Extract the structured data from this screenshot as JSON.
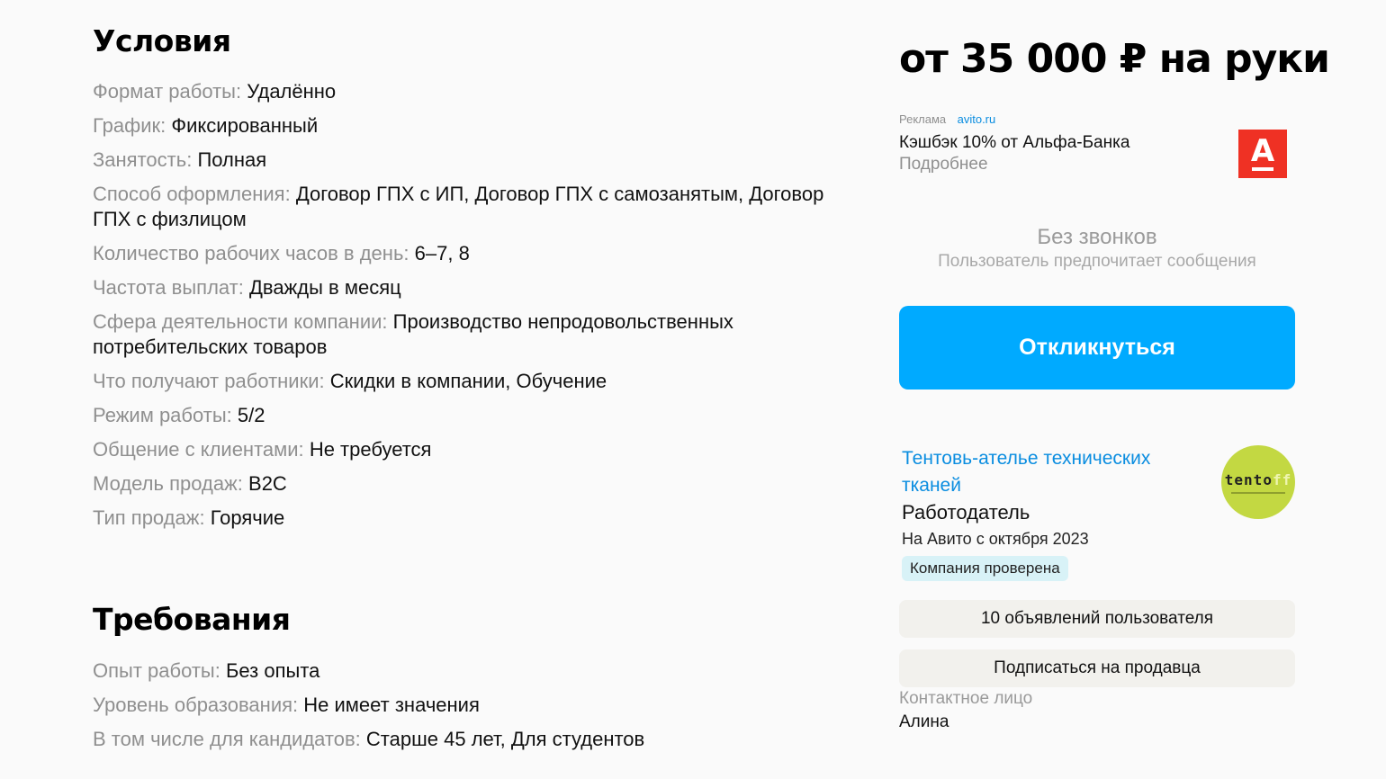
{
  "conditions": {
    "title": "Условия",
    "params": [
      {
        "label": "Формат работы:",
        "value": "Удалённо"
      },
      {
        "label": "График:",
        "value": "Фиксированный"
      },
      {
        "label": "Занятость:",
        "value": "Полная"
      },
      {
        "label": "Способ оформления:",
        "value": "Договор ГПХ с ИП, Договор ГПХ с самозанятым, Договор ГПХ с физлицом"
      },
      {
        "label": "Количество рабочих часов в день:",
        "value": "6–7, 8"
      },
      {
        "label": "Частота выплат:",
        "value": "Дважды в месяц"
      },
      {
        "label": "Сфера деятельности компании:",
        "value": "Производство непродовольственных потребительских товаров"
      },
      {
        "label": "Что получают работники:",
        "value": "Скидки в компании, Обучение"
      },
      {
        "label": "Режим работы:",
        "value": "5/2"
      },
      {
        "label": "Общение с клиентами:",
        "value": "Не требуется"
      },
      {
        "label": "Модель продаж:",
        "value": "B2C"
      },
      {
        "label": "Тип продаж:",
        "value": "Горячие"
      }
    ]
  },
  "requirements": {
    "title": "Требования",
    "params": [
      {
        "label": "Опыт работы:",
        "value": "Без опыта"
      },
      {
        "label": "Уровень образования:",
        "value": "Не имеет значения"
      },
      {
        "label": "В том числе для кандидатов:",
        "value": "Старше 45 лет, Для студентов"
      }
    ]
  },
  "sidebar": {
    "price": "от 35 000 ₽ на руки",
    "ad": {
      "label": "Реклама",
      "domain": "avito.ru",
      "title": "Кэшбэк 10% от Альфа-Банка",
      "more": "Подробнее",
      "logo_letter": "А",
      "logo_color": "#ef3124"
    },
    "no_calls": {
      "title": "Без звонков",
      "subtitle": "Пользователь предпочитает сообщения"
    },
    "respond_button": "Откликнуться",
    "company": {
      "name": "Тентовь-ателье технических тканей",
      "role": "Работодатель",
      "since": "На Авито с октября 2023",
      "verified_badge": "Компания проверена",
      "logo_text_main": "tento",
      "logo_text_accent": "ff"
    },
    "listings_button": "10 объявлений пользователя",
    "subscribe_button": "Подписаться на продавца",
    "contact": {
      "label": "Контактное лицо",
      "name": "Алина"
    }
  },
  "colors": {
    "accent_blue": "#00aaff",
    "link_blue": "#0a8de0",
    "verified_bg": "#d8f2f7"
  }
}
